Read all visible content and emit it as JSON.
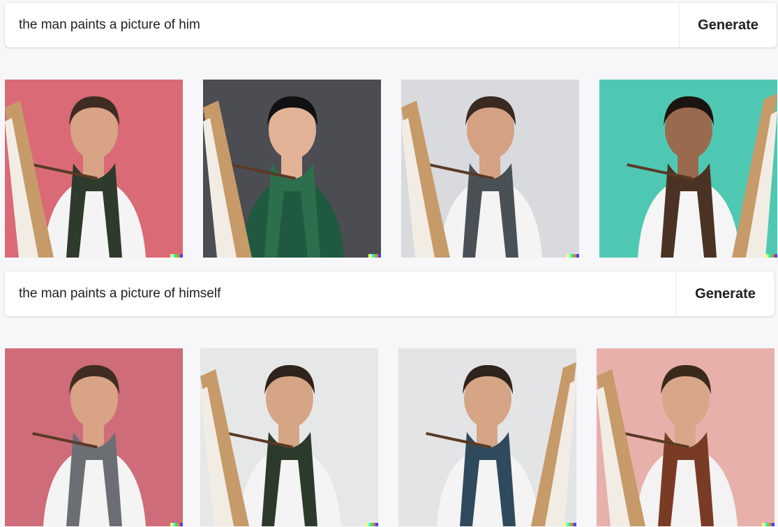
{
  "rows": [
    {
      "prompt": "the man paints a picture of him",
      "generate_label": "Generate"
    },
    {
      "prompt": "the man paints a picture of himself",
      "generate_label": "Generate"
    }
  ],
  "colors": {
    "background": "#f7f7f9",
    "bar": "#ffffff",
    "text": "#202123",
    "watermark": [
      "#ffff66",
      "#42ffff",
      "#51da4c",
      "#ff6e3c",
      "#3c46ff"
    ]
  },
  "icons": [
    "dalle-watermark-icon"
  ],
  "images": [
    {
      "bg": "#d96a76",
      "skin": "#d9a386",
      "hair": "#3f2c22",
      "shirt": "#f4f4f4",
      "scarf": "#2e3a2b",
      "easel": "left"
    },
    {
      "bg": "#4b4d52",
      "skin": "#e1b295",
      "hair": "#111111",
      "shirt": "#1f5a40",
      "scarf": "#2d6f4c",
      "easel": "left"
    },
    {
      "bg": "#d8dadd",
      "skin": "#d4a183",
      "hair": "#3a2a20",
      "shirt": "#f4f4f4",
      "scarf": "#4a5156",
      "easel": "left"
    },
    {
      "bg": "#4fc8b3",
      "skin": "#9a6a4f",
      "hair": "#1c1410",
      "shirt": "#f5f5f5",
      "scarf": "#4a3324",
      "easel": "right"
    },
    {
      "bg": "#cf6c7a",
      "skin": "#d9a386",
      "hair": "#3f2c22",
      "shirt": "#f4f4f4",
      "scarf": "#6b6f74",
      "easel": "none"
    },
    {
      "bg": "#e6e8e8",
      "skin": "#d6a586",
      "hair": "#2f231b",
      "shirt": "#f4f4f4",
      "scarf": "#2c3a2c",
      "easel": "left"
    },
    {
      "bg": "#e3e4e6",
      "skin": "#d6a586",
      "hair": "#2f231b",
      "shirt": "#f4f4f4",
      "scarf": "#2f4a5c",
      "easel": "right"
    },
    {
      "bg": "#e8b0ab",
      "skin": "#d8a789",
      "hair": "#3a2a1c",
      "shirt": "#f3f3f3",
      "scarf": "#7a3b25",
      "easel": "left"
    }
  ]
}
